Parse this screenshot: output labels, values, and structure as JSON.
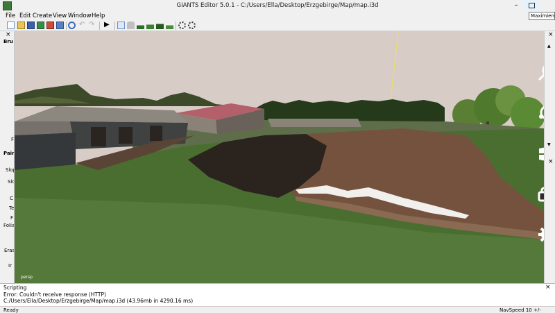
{
  "window": {
    "title": "GIANTS Editor 5.0.1 - C:/Users/Ella/Desktop/Erzgebirge/Map/map.i3d",
    "minimize_glyph": "–",
    "tooltip": "Maximieren",
    "close_glyph": "×"
  },
  "menu": [
    "File",
    "Edit",
    "Create",
    "View",
    "Window",
    "Help"
  ],
  "toolbar": {
    "icons": [
      "new-file-icon",
      "open-folder-icon",
      "save-icon",
      "save-as-icon",
      "export-icon",
      "import-icon",
      "refresh-icon",
      "undo-icon",
      "redo-icon",
      "play-icon",
      "select-tool-icon",
      "move-tool-icon",
      "terrain-sculpt-icon",
      "terrain-paint-icon",
      "foliage-paint-icon",
      "terrain-smooth-icon",
      "gear-brush-icon",
      "settings-brush-icon"
    ]
  },
  "left_panel": {
    "close_glyph": "×",
    "labels": [
      "Bru",
      "F",
      "Pair",
      "Slop",
      "Slo",
      "C",
      "Te",
      "F",
      "Folia",
      "Eras",
      "Ir"
    ]
  },
  "viewport": {
    "camera_label": "persp",
    "charms": [
      "search-icon",
      "share-icon",
      "windows-start-icon",
      "devices-icon",
      "settings-gear-icon"
    ]
  },
  "console": {
    "title": "Scripting",
    "lines": [
      "Error: Couldn't receive response (HTTP)",
      "C:/Users/Ella/Desktop/Erzgebirge/Map/map.i3d (43.96mb in 4290.16 ms)"
    ]
  },
  "status": {
    "left": "Ready",
    "right": "NavSpeed 10 +/-"
  },
  "colors": {
    "sky": "#d9ccc7",
    "grass": "#4f7434",
    "dirt": "#6b4a3a",
    "charm_icon": "#ffffff"
  }
}
